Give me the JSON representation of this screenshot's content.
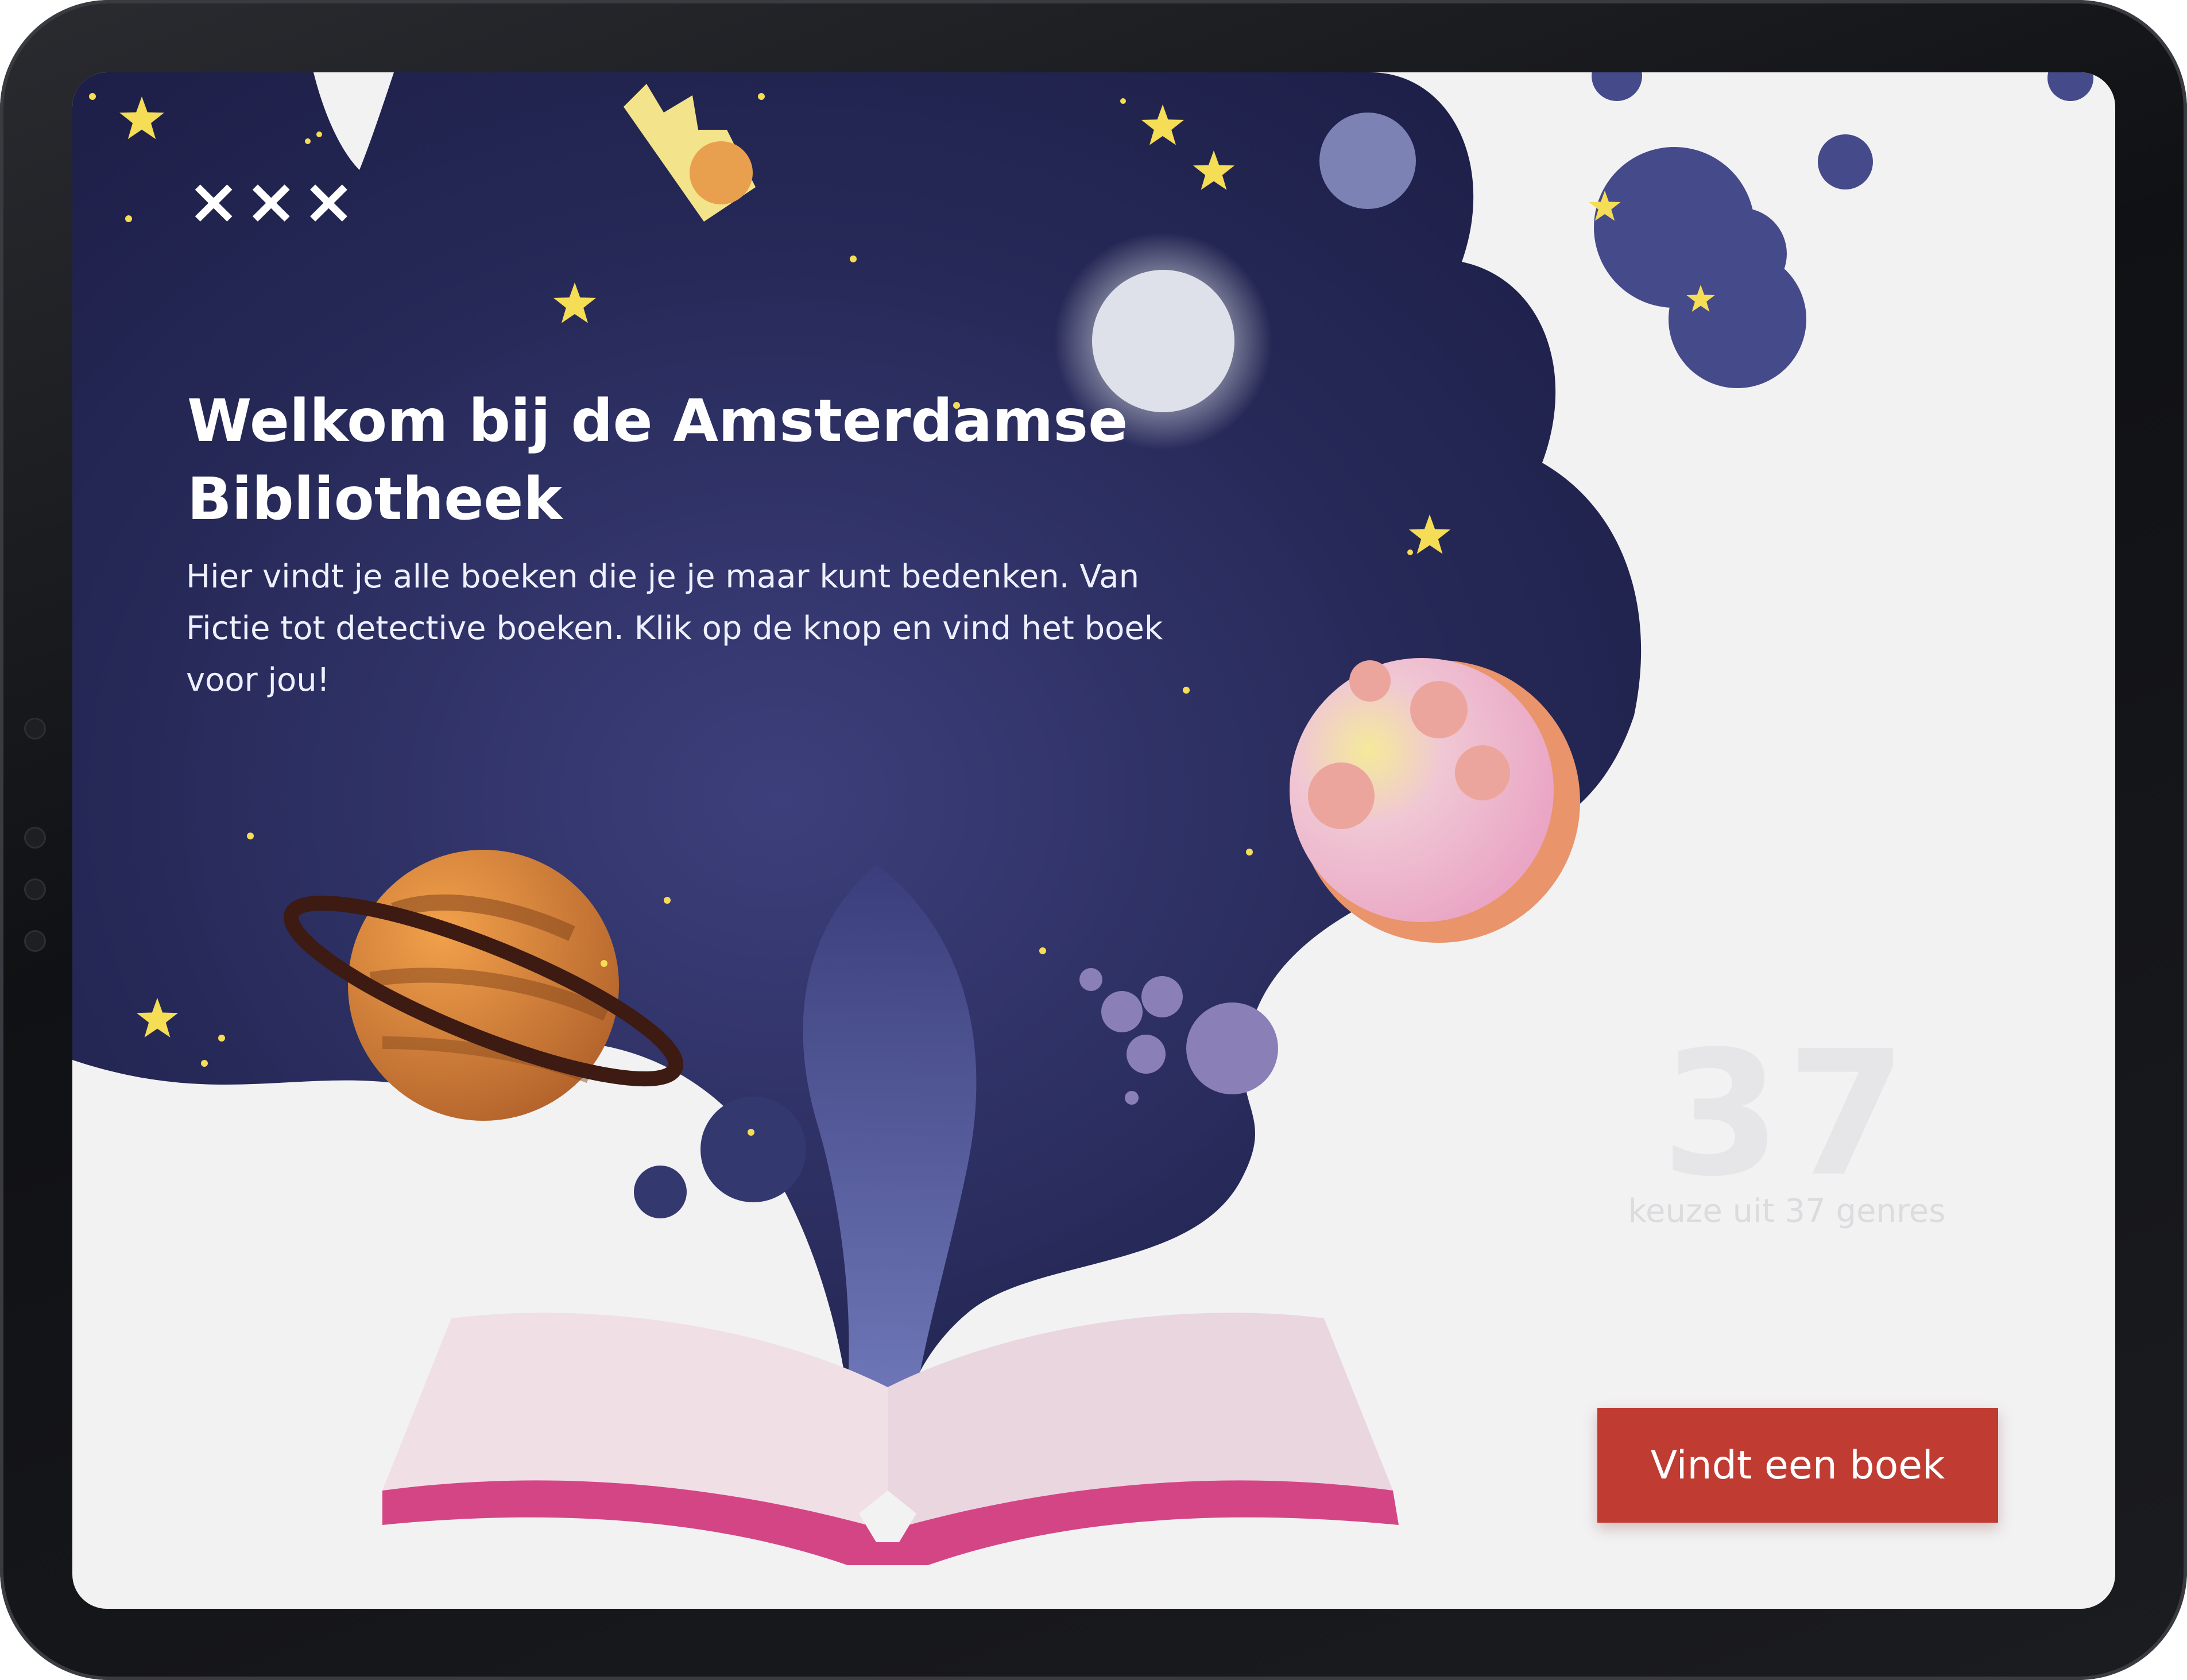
{
  "logo": {
    "text": "×××"
  },
  "hero": {
    "title": "Welkom bij de Amsterdamse Bibliotheek",
    "description": "Hier vindt je alle boeken die je je maar kunt bedenken. Van Fictie tot detective boeken. Klik op de knop en vind het boek voor jou!"
  },
  "counter": {
    "number": "37",
    "label": "keuze uit 37 genres"
  },
  "cta": {
    "label": "Vindt een boek"
  },
  "colors": {
    "space": "#272a55",
    "button": "#c03b31",
    "book_cover": "#d44585",
    "star": "#f5dd55",
    "background": "#f2f2f3"
  },
  "icons": [
    "star-icon",
    "planet-icon",
    "moon-icon",
    "comet-icon",
    "book-icon"
  ]
}
